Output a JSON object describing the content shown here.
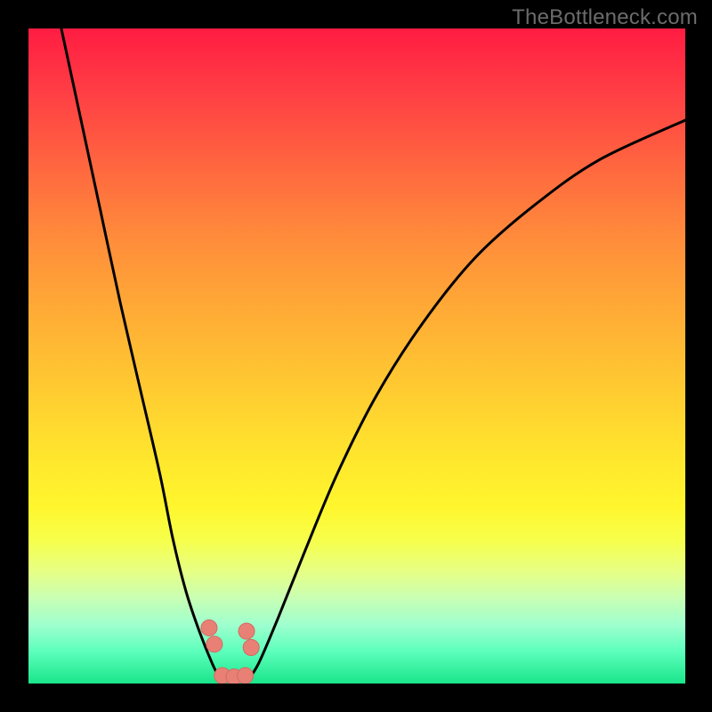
{
  "watermark": "TheBottleneck.com",
  "colors": {
    "frame": "#000000",
    "gradient_top": "#ff1c42",
    "gradient_bottom": "#19e58a",
    "curve": "#000000",
    "marker_fill": "#e98076",
    "marker_stroke": "#d46a60",
    "watermark_text": "#6b6b6b"
  },
  "chart_data": {
    "type": "line",
    "title": "",
    "xlabel": "",
    "ylabel": "",
    "xlim": [
      0,
      100
    ],
    "ylim": [
      0,
      100
    ],
    "note": "X and Y are normalized 0–100 to the plot area (no visible axis ticks/labels in source). Lower Y = bottom.",
    "series": [
      {
        "name": "left-curve",
        "x": [
          5,
          8,
          11,
          14,
          17,
          20,
          22,
          24,
          26,
          28,
          29.5
        ],
        "y": [
          100,
          86,
          72,
          58,
          45,
          32,
          22,
          14,
          8,
          3,
          0
        ]
      },
      {
        "name": "right-curve",
        "x": [
          33,
          35,
          38,
          42,
          47,
          53,
          60,
          68,
          77,
          87,
          100
        ],
        "y": [
          0,
          3,
          10,
          20,
          32,
          44,
          55,
          65,
          73,
          80,
          86
        ]
      }
    ],
    "markers": [
      {
        "name": "left-pair-top",
        "x": 27.5,
        "y": 8.5
      },
      {
        "name": "left-pair-bottom",
        "x": 28.3,
        "y": 6.0
      },
      {
        "name": "right-pair-top",
        "x": 33.2,
        "y": 8.0
      },
      {
        "name": "right-pair-bottom",
        "x": 33.9,
        "y": 5.5
      },
      {
        "name": "bottom-left",
        "x": 29.5,
        "y": 1.2
      },
      {
        "name": "bottom-mid",
        "x": 31.3,
        "y": 1.0
      },
      {
        "name": "bottom-right",
        "x": 33.0,
        "y": 1.2
      }
    ]
  }
}
